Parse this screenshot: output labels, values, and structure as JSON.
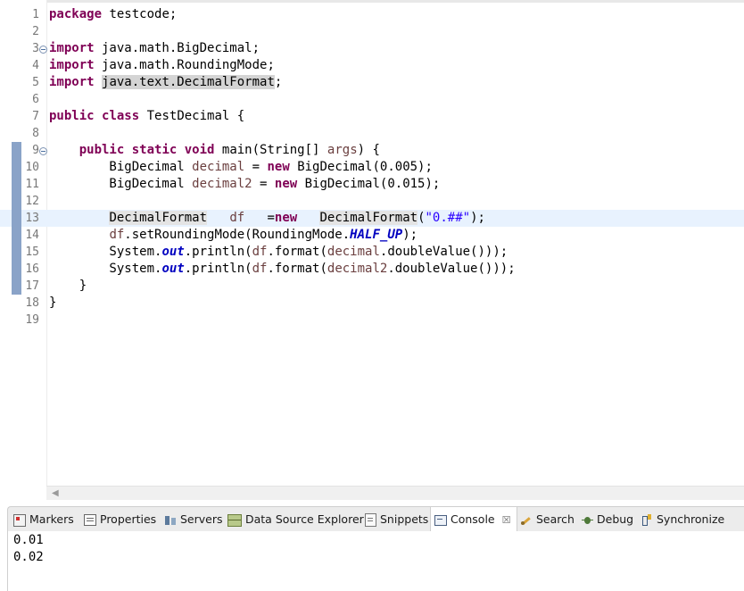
{
  "editor": {
    "lines": [
      {
        "num": "1",
        "segments": [
          {
            "t": "package",
            "c": "kw"
          },
          {
            "t": " testcode;"
          }
        ]
      },
      {
        "num": "2",
        "segments": []
      },
      {
        "num": "3",
        "fold": true,
        "segments": [
          {
            "t": "import",
            "c": "kw"
          },
          {
            "t": " java.math.BigDecimal;"
          }
        ]
      },
      {
        "num": "4",
        "segments": [
          {
            "t": "import",
            "c": "kw"
          },
          {
            "t": " java.math.RoundingMode;"
          }
        ]
      },
      {
        "num": "5",
        "segments": [
          {
            "t": "import",
            "c": "kw"
          },
          {
            "t": " "
          },
          {
            "t": "java.text.DecimalFormat",
            "c": "occ"
          },
          {
            "t": ";"
          }
        ]
      },
      {
        "num": "6",
        "segments": []
      },
      {
        "num": "7",
        "segments": [
          {
            "t": "public",
            "c": "kw"
          },
          {
            "t": " "
          },
          {
            "t": "class",
            "c": "kw"
          },
          {
            "t": " TestDecimal {"
          }
        ]
      },
      {
        "num": "8",
        "segments": []
      },
      {
        "num": "9",
        "fold": true,
        "marker": true,
        "segments": [
          {
            "t": "    "
          },
          {
            "t": "public",
            "c": "kw"
          },
          {
            "t": " "
          },
          {
            "t": "static",
            "c": "kw"
          },
          {
            "t": " "
          },
          {
            "t": "void",
            "c": "kw"
          },
          {
            "t": " main(String[] "
          },
          {
            "t": "args",
            "c": "var"
          },
          {
            "t": ") {"
          }
        ]
      },
      {
        "num": "10",
        "marker": true,
        "segments": [
          {
            "t": "        BigDecimal "
          },
          {
            "t": "decimal",
            "c": "var"
          },
          {
            "t": " = "
          },
          {
            "t": "new",
            "c": "kw"
          },
          {
            "t": " BigDecimal(0.005);"
          }
        ]
      },
      {
        "num": "11",
        "marker": true,
        "segments": [
          {
            "t": "        BigDecimal "
          },
          {
            "t": "decimal2",
            "c": "var"
          },
          {
            "t": " = "
          },
          {
            "t": "new",
            "c": "kw"
          },
          {
            "t": " BigDecimal(0.015);"
          }
        ]
      },
      {
        "num": "12",
        "marker": true,
        "segments": []
      },
      {
        "num": "13",
        "marker": true,
        "current": true,
        "segments": [
          {
            "t": "        "
          },
          {
            "t": "DecimalFormat",
            "c": "occ-light"
          },
          {
            "t": "   "
          },
          {
            "t": "df",
            "c": "var"
          },
          {
            "t": "   ="
          },
          {
            "t": "new",
            "c": "kw"
          },
          {
            "t": "   "
          },
          {
            "t": "DecimalFormat",
            "c": "occ-light"
          },
          {
            "t": "("
          },
          {
            "t": "\"0.##\"",
            "c": "str"
          },
          {
            "t": ");"
          }
        ]
      },
      {
        "num": "14",
        "marker": true,
        "segments": [
          {
            "t": "        "
          },
          {
            "t": "df",
            "c": "var"
          },
          {
            "t": ".setRoundingMode(RoundingMode."
          },
          {
            "t": "HALF_UP",
            "c": "static-field"
          },
          {
            "t": ");"
          }
        ]
      },
      {
        "num": "15",
        "marker": true,
        "segments": [
          {
            "t": "        System."
          },
          {
            "t": "out",
            "c": "static-field"
          },
          {
            "t": ".println("
          },
          {
            "t": "df",
            "c": "var"
          },
          {
            "t": ".format("
          },
          {
            "t": "decimal",
            "c": "var"
          },
          {
            "t": ".doubleValue()));"
          }
        ]
      },
      {
        "num": "16",
        "marker": true,
        "segments": [
          {
            "t": "        System."
          },
          {
            "t": "out",
            "c": "static-field"
          },
          {
            "t": ".println("
          },
          {
            "t": "df",
            "c": "var"
          },
          {
            "t": ".format("
          },
          {
            "t": "decimal2",
            "c": "var"
          },
          {
            "t": ".doubleValue()));"
          }
        ]
      },
      {
        "num": "17",
        "marker": true,
        "segments": [
          {
            "t": "    }"
          }
        ]
      },
      {
        "num": "18",
        "segments": [
          {
            "t": "}"
          }
        ]
      },
      {
        "num": "19",
        "segments": []
      }
    ]
  },
  "views": {
    "tabs": [
      {
        "label": "Markers",
        "icon": "markers-icon"
      },
      {
        "label": "Properties",
        "icon": "properties-icon"
      },
      {
        "label": "Servers",
        "icon": "servers-icon"
      },
      {
        "label": "Data Source Explorer",
        "icon": "data-source-explorer-icon"
      },
      {
        "label": "Snippets",
        "icon": "snippets-icon"
      },
      {
        "label": "Console",
        "icon": "console-icon",
        "active": true,
        "close": "☒"
      },
      {
        "label": "Search",
        "icon": "search-icon"
      },
      {
        "label": "Debug",
        "icon": "debug-icon"
      },
      {
        "label": "Synchronize",
        "icon": "synchronize-icon"
      }
    ]
  },
  "console": {
    "output": [
      "0.01",
      "0.02"
    ]
  },
  "colors": {
    "keyword": "#7f0055",
    "local_variable": "#6a3e3e",
    "string": "#2a00ff",
    "static_field": "#0000c0",
    "current_line": "#e8f2fe",
    "change_marker": "#8aa3c8"
  }
}
